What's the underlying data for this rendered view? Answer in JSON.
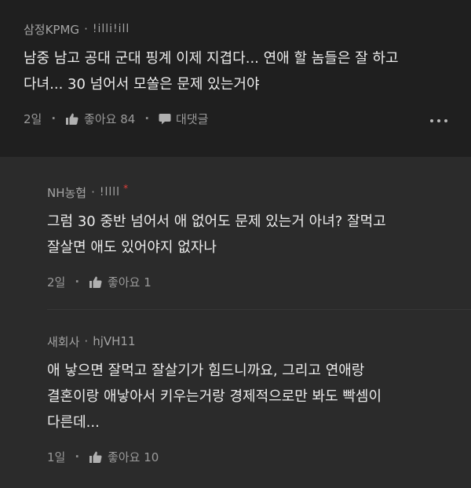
{
  "post": {
    "author": "삼정KPMG",
    "author_suffix": "!illi!ill",
    "lines": [
      "남중 남고 공대 군대 핑계 이제 지겹다... 연애 할 놈들은 잘 하고",
      "다녀... 30 넘어서 모쏠은 문제 있는거야"
    ],
    "time": "2일",
    "like_label": "좋아요 84",
    "reply_label": "대댓글"
  },
  "replies": [
    {
      "author": "NH농협",
      "author_suffix": "!llll",
      "author_badge": "*",
      "lines": [
        "그럼 30 중반 넘어서 애 없어도 문제 있는거 아녀? 잘먹고",
        "잘살면 애도 있어야지 없자나"
      ],
      "time": "2일",
      "like_label": "좋아요 1"
    },
    {
      "author": "새회사",
      "author_suffix": "hjVH11",
      "lines": [
        "애 낳으면 잘먹고 잘살기가 힘드니까요, 그리고 연애랑",
        "결혼이랑 애낳아서 키우는거랑 경제적으로만 봐도 빡셈이",
        "다른데..."
      ],
      "time": "1일",
      "like_label": "좋아요 10"
    }
  ],
  "icons": {
    "like": "thumbs-up-icon",
    "reply": "speech-bubble-icon",
    "more": "more-dots-icon"
  },
  "colors": {
    "accent_badge": "#e0403b",
    "background": "#1f1f1f",
    "reply_background": "#2b2b2b"
  }
}
